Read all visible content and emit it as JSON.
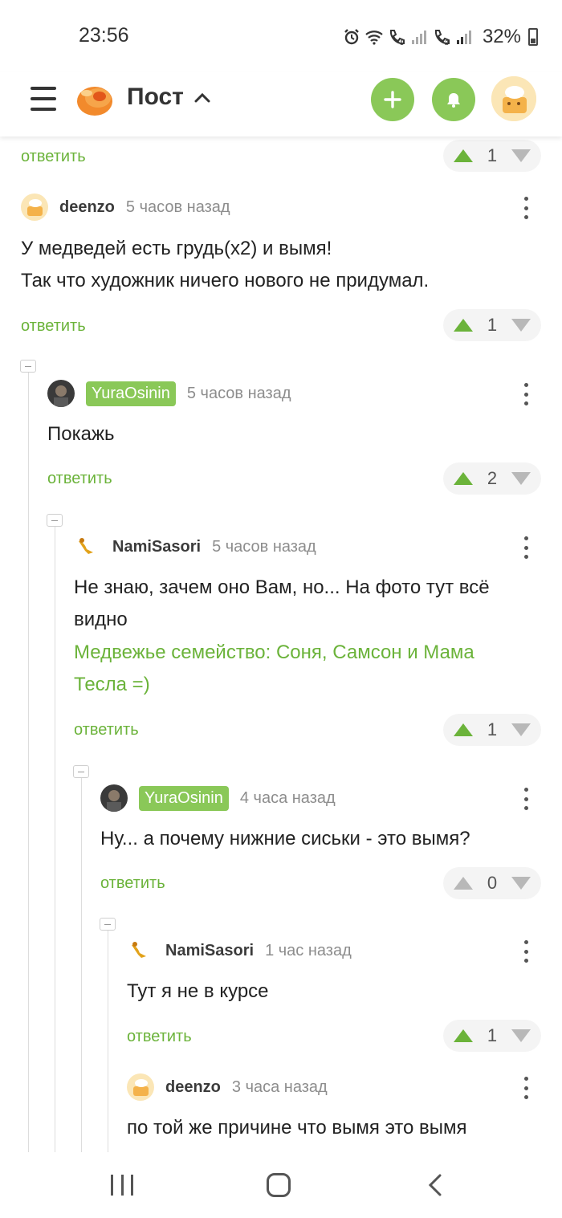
{
  "status_bar": {
    "time": "23:56",
    "battery": "32%",
    "icons": [
      "alarm-icon",
      "wifi-icon",
      "call-sim1-icon",
      "signal-icon",
      "call-sim2-icon",
      "signal-icon",
      "battery-icon"
    ]
  },
  "header": {
    "title": "Пост",
    "menu_icon": "hamburger-icon",
    "logo_icon": "pikabu-logo-icon",
    "add_icon": "plus-icon",
    "bell_icon": "bell-icon"
  },
  "colors": {
    "accent_green": "#8ac858",
    "link_green": "#6bb33a",
    "vote_up_active": "#6bb33a",
    "vote_inactive": "#b8b8b8"
  },
  "top_actions": {
    "reply_label": "ответить",
    "rating": "1",
    "up_active": true
  },
  "comments": [
    {
      "author": "deenzo",
      "is_op": false,
      "time": "5 часов назад",
      "lines": [
        "У медведей есть грудь(x2) и вымя!",
        "Так что художник ничего нового не придумал."
      ],
      "reply_label": "ответить",
      "rating": "1",
      "up_active": true
    },
    {
      "author": "YuraOsinin",
      "is_op": true,
      "time": "5 часов назад",
      "lines": [
        "Покажь"
      ],
      "reply_label": "ответить",
      "rating": "2",
      "up_active": true
    },
    {
      "author": "NamiSasori",
      "is_op": false,
      "time": "5 часов назад",
      "lines": [
        "Не знаю, зачем оно Вам, но... На фото тут всё",
        "видно"
      ],
      "link_lines": [
        "Медвежье семейство: Соня, Самсон и Мама",
        "Тесла =)"
      ],
      "reply_label": "ответить",
      "rating": "1",
      "up_active": true
    },
    {
      "author": "YuraOsinin",
      "is_op": true,
      "time": "4 часа назад",
      "lines": [
        "Ну... а почему нижние сиськи - это вымя?"
      ],
      "reply_label": "ответить",
      "rating": "0",
      "up_active": false
    },
    {
      "author": "NamiSasori",
      "is_op": false,
      "time": "1 час назад",
      "lines": [
        "Тут я не в курсе"
      ],
      "reply_label": "ответить",
      "rating": "1",
      "up_active": true
    },
    {
      "author": "deenzo",
      "is_op": false,
      "time": "3 часа назад",
      "lines": [
        "по той же причине что вымя это вымя"
      ]
    }
  ],
  "nav_bar": {
    "recents_icon": "recents-icon",
    "home_icon": "home-icon",
    "back_icon": "back-icon"
  }
}
